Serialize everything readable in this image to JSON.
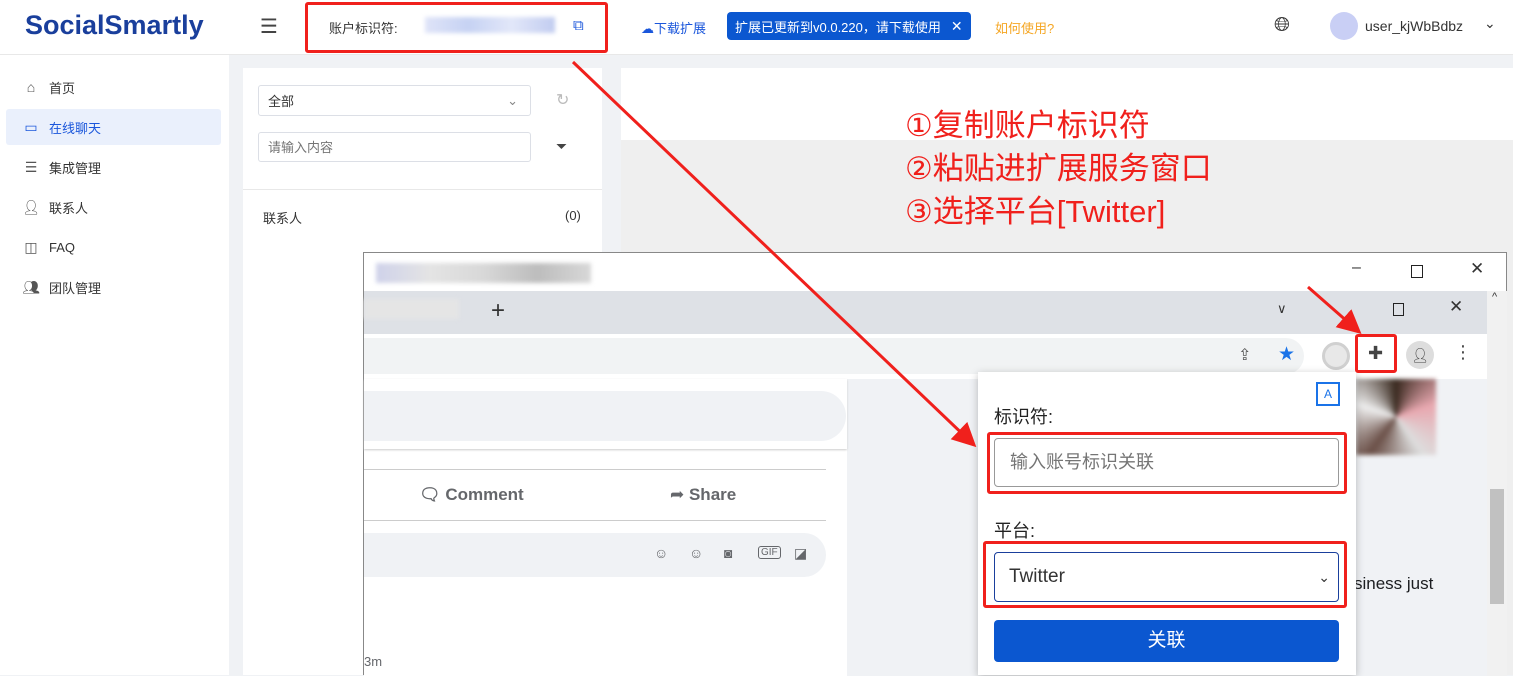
{
  "header": {
    "logo": "SocialSmartly",
    "account_id_label": "账户标识符:",
    "download_ext": "下载扩展",
    "update_notice": "扩展已更新到v0.0.220，请下载使用",
    "how_to_use": "如何使用",
    "username": "user_kjWbBdbz"
  },
  "sidebar": {
    "items": [
      {
        "label": "首页",
        "icon": "home-icon"
      },
      {
        "label": "在线聊天",
        "icon": "chat-icon",
        "active": true
      },
      {
        "label": "集成管理",
        "icon": "list-icon"
      },
      {
        "label": "联系人",
        "icon": "user-icon"
      },
      {
        "label": "FAQ",
        "icon": "help-icon"
      },
      {
        "label": "团队管理",
        "icon": "team-icon"
      }
    ]
  },
  "contacts": {
    "filter_value": "全部",
    "search_placeholder": "请输入内容",
    "section_label": "联系人",
    "section_count": "(0)"
  },
  "annotations": [
    "①复制账户标识符",
    "②粘贴进扩展服务窗口",
    "③选择平台[Twitter]"
  ],
  "browser": {
    "new_tab": "+",
    "post_actions": {
      "comment": "Comment",
      "share": "Share"
    },
    "partial_text": "siness just",
    "time_text": "3m"
  },
  "popup": {
    "identifier_label": "标识符:",
    "identifier_placeholder": "输入账号标识关联",
    "platform_label": "平台:",
    "platform_value": "Twitter",
    "submit": "关联"
  },
  "colors": {
    "brand": "#1a3f9c",
    "accent": "#1a56db",
    "annotation": "#f0201c",
    "notice_bg": "#0b57d0",
    "link_orange": "#f5a623"
  }
}
